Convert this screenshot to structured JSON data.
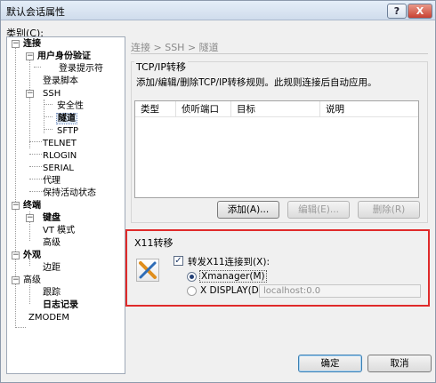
{
  "window": {
    "title": "默认会话属性",
    "help_label": "?",
    "close_label": "X"
  },
  "sidebar": {
    "category_label": "类别(C):",
    "tree": {
      "connection": "连接",
      "auth": "用户身份验证",
      "login_prompt": "登录提示符",
      "login_script": "登录脚本",
      "ssh": "SSH",
      "security": "安全性",
      "tunnel": "隧道",
      "sftp": "SFTP",
      "telnet": "TELNET",
      "rlogin": "RLOGIN",
      "serial": "SERIAL",
      "proxy": "代理",
      "keepalive": "保持活动状态",
      "terminal": "终端",
      "keyboard": "键盘",
      "vt_mode": "VT 模式",
      "term_advanced": "高级",
      "appearance": "外观",
      "margin": "边距",
      "advanced": "高级",
      "trace": "跟踪",
      "logging": "日志记录",
      "zmodem": "ZMODEM"
    }
  },
  "main": {
    "breadcrumb": "连接 > SSH > 隧道",
    "tcpip": {
      "title": "TCP/IP转移",
      "description": "添加/编辑/删除TCP/IP转移规则。此规则连接后自动应用。",
      "columns": [
        "类型",
        "侦听端口",
        "目标",
        "说明"
      ],
      "add_label": "添加(A)...",
      "edit_label": "编辑(E)...",
      "delete_label": "删除(R)"
    },
    "x11": {
      "title": "X11转移",
      "forward_label": "转发X11连接到(X):",
      "forward_checked": true,
      "xmanager_label": "Xmanager(M)",
      "display_label": "X DISPLAY(D):",
      "display_value": "localhost:0.0"
    }
  },
  "footer": {
    "ok_label": "确定",
    "cancel_label": "取消"
  }
}
